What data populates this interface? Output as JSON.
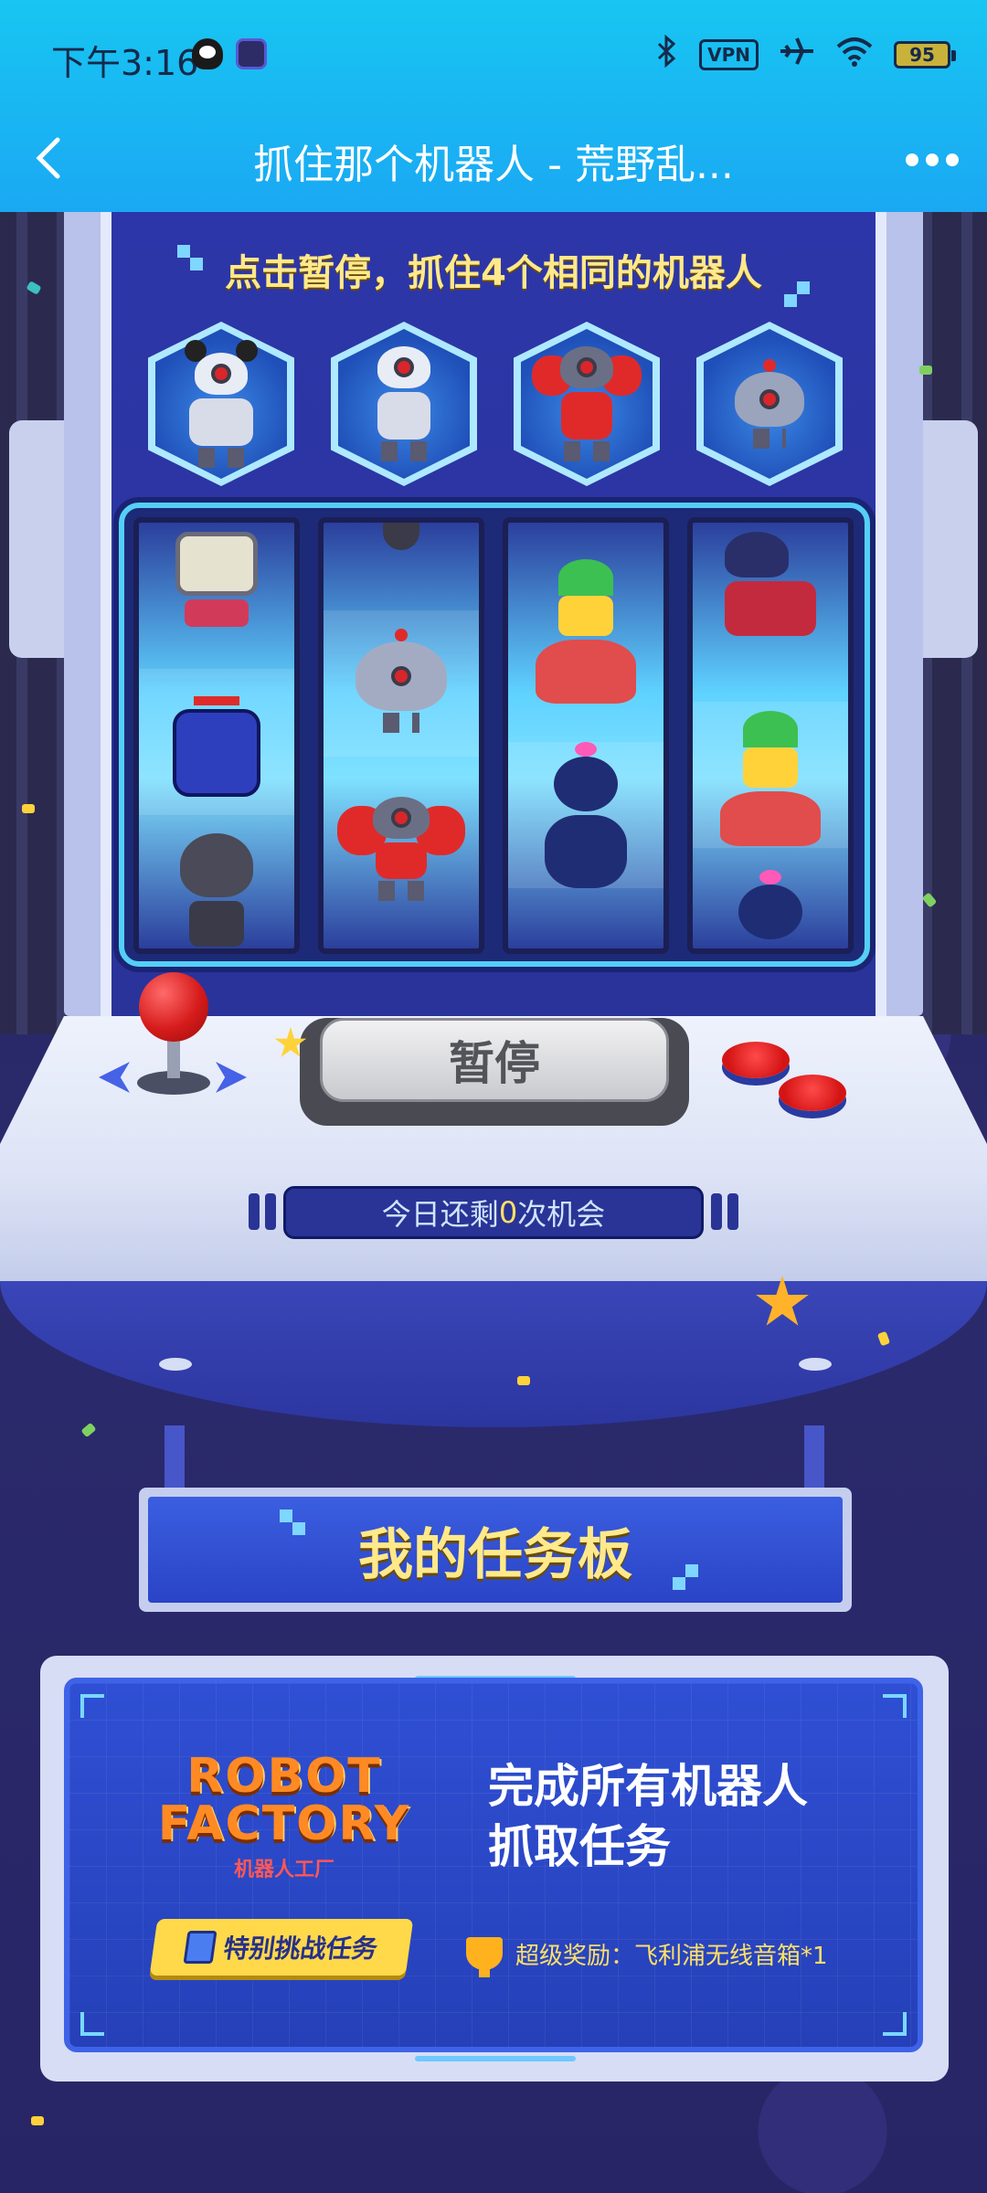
{
  "status_bar": {
    "time": "下午3:16",
    "vpn": "VPN",
    "battery": "95"
  },
  "nav": {
    "title": "抓住那个机器人 - 荒野乱..."
  },
  "game": {
    "instruction": "点击暂停，抓住4个相同的机器人",
    "pause_label": "暂停",
    "chances_prefix": "今日还剩",
    "chances_count": "0",
    "chances_suffix": "次机会",
    "targets": [
      "robot-mouse-ears",
      "robot-white",
      "robot-boxer",
      "robot-round"
    ],
    "reels": [
      [
        "robot-green-screen",
        "ninja-robot",
        "kid-with-bat"
      ],
      [
        "robot-round",
        "robot-boxer"
      ],
      [
        "flower-shirt-brawler",
        "dark-brawler-bow"
      ],
      [
        "pilot-brawler",
        "flower-shirt-brawler",
        "dark-brawler-bow"
      ]
    ]
  },
  "board": {
    "title": "我的任务板"
  },
  "task": {
    "logo_line1": "ROBOT",
    "logo_line2": "FACTORY",
    "logo_cn": "机器人工厂",
    "tag": "特别挑战任务",
    "title_line1": "完成所有机器人",
    "title_line2": "抓取任务",
    "reward": "超级奖励：飞利浦无线音箱*1"
  }
}
